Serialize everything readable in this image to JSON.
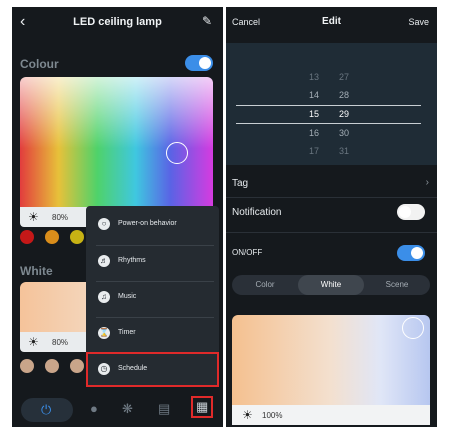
{
  "left_screen": {
    "header": {
      "back_icon": "chevron-left",
      "title": "LED ceiling lamp",
      "edit_icon": "pencil"
    },
    "colour_section": {
      "label": "Colour",
      "toggle_on": true,
      "brightness": "80%"
    },
    "colour_swatches": [
      "#c41818",
      "#d98d1b",
      "#c7b214",
      "#e8d8a8"
    ],
    "white_section": {
      "label": "White",
      "brightness": "80%"
    },
    "white_swatches": [
      "#c9a58a",
      "#c9a58a",
      "#c9a58a"
    ],
    "menu": {
      "items": [
        {
          "icon": "power-on-icon",
          "label": "Power-on behavior"
        },
        {
          "icon": "rhythms-icon",
          "label": "Rhythms"
        },
        {
          "icon": "music-icon",
          "label": "Music"
        },
        {
          "icon": "timer-icon",
          "label": "Timer"
        },
        {
          "icon": "schedule-icon",
          "label": "Schedule"
        }
      ],
      "highlighted": "Schedule",
      "highlight_color": "#e02a2a"
    },
    "bottom_nav": [
      "power-icon",
      "bulb-icon",
      "palette-icon",
      "device-icon",
      "grid-icon"
    ]
  },
  "right_screen": {
    "header": {
      "cancel": "Cancel",
      "title": "Edit",
      "save": "Save"
    },
    "time_picker": {
      "hours": [
        "13",
        "14",
        "15",
        "16",
        "17"
      ],
      "minutes": [
        "27",
        "28",
        "29",
        "30",
        "31"
      ],
      "selected_hour": "15",
      "selected_minute": "29"
    },
    "tag_label": "Tag",
    "notification_label": "Notification",
    "notification_on": false,
    "onoff_label": "ON/OFF",
    "onoff_on": true,
    "tabs": [
      "Color",
      "White",
      "Scene"
    ],
    "active_tab": "White",
    "brightness": "100%"
  },
  "colors": {
    "accent": "#3b8ee8",
    "background": "#15191d",
    "highlight": "#e02a2a"
  }
}
